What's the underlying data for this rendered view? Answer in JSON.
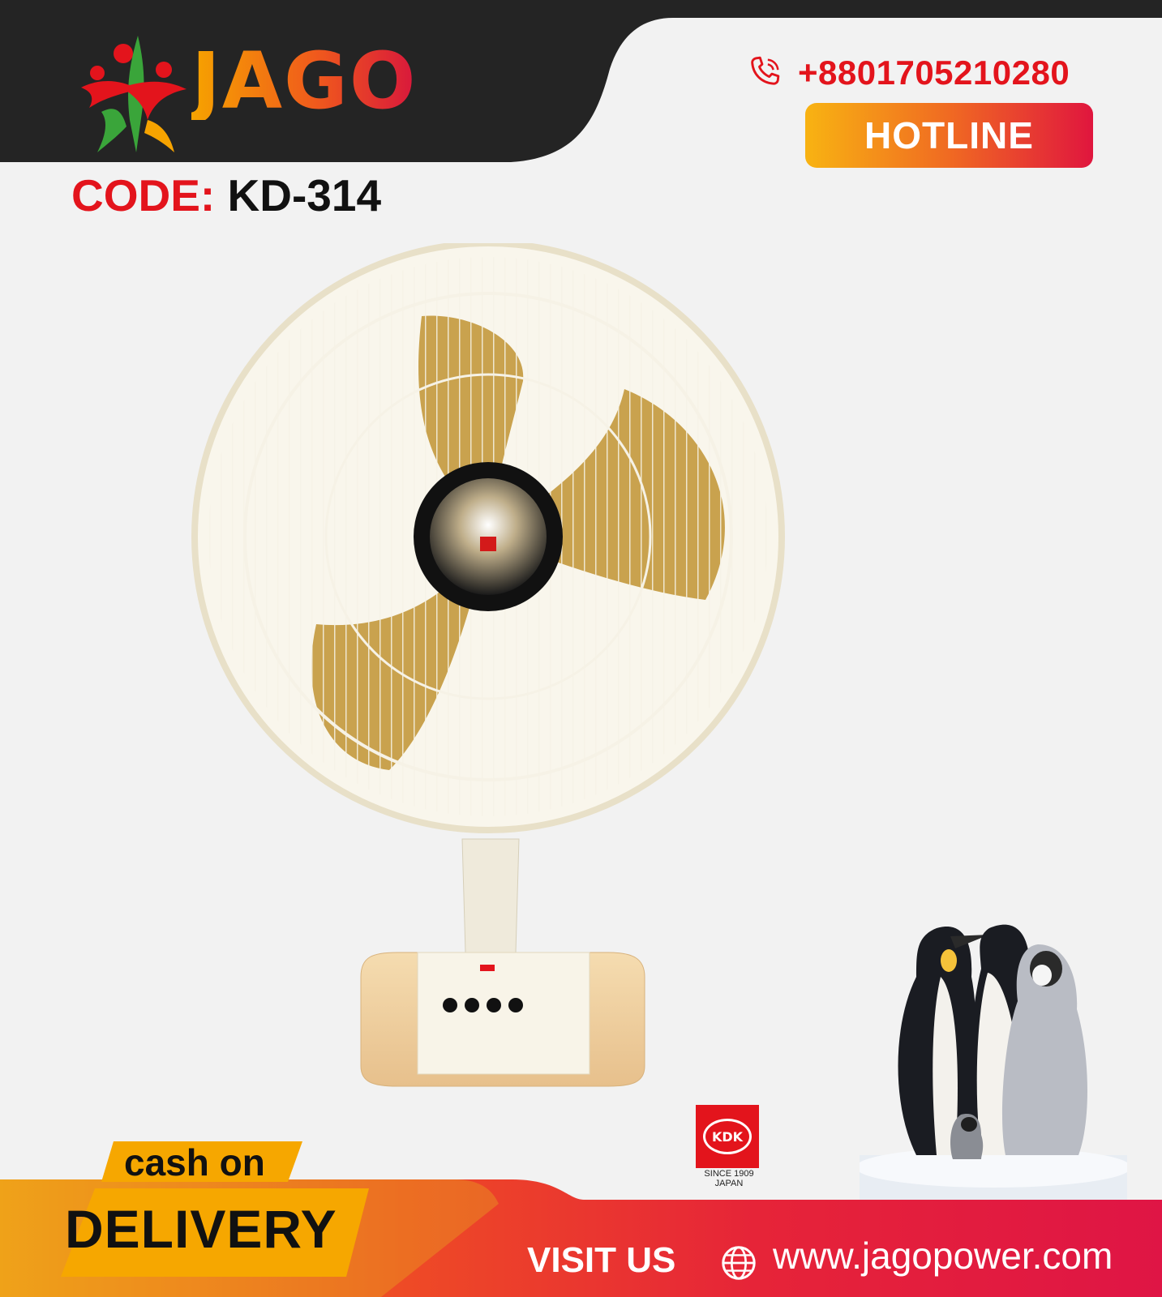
{
  "brand": {
    "logo_text": "JAGO"
  },
  "product": {
    "code_label": "CODE:",
    "code_value": "KD-314"
  },
  "contact": {
    "phone": "+8801705210280",
    "hotline_label": "HOTLINE"
  },
  "delivery_badge": {
    "line1": "cash on",
    "line2": "DELIVERY"
  },
  "footer": {
    "visit_label": "VISIT US",
    "website": "www.jagopower.com"
  },
  "kdk_badge": {
    "logo_text": "KDK",
    "since": "SINCE 1909",
    "country": "JAPAN"
  },
  "colors": {
    "red": "#e3141c",
    "orange": "#f06a22",
    "yellow": "#f8b312",
    "dark": "#242424",
    "background": "#f2f2f2"
  },
  "icons": [
    "phone-icon",
    "globe-icon",
    "people-figures-icon"
  ]
}
